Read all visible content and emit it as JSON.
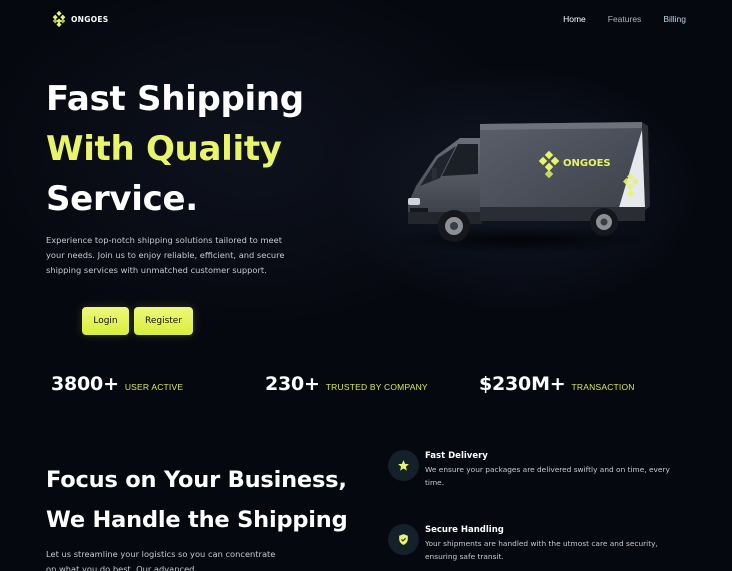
{
  "brand": {
    "name": "ONGOES",
    "accent": "#e8f46a"
  },
  "nav": {
    "items": [
      "Home",
      "Features",
      "Billing"
    ],
    "active": "Home"
  },
  "hero": {
    "title_line1": "Fast Shipping",
    "title_line2": "With Quality",
    "title_line3": "Service.",
    "description": "Experience top-notch shipping solutions tailored to meet your needs. Join us to enjoy reliable, efficient, and secure shipping services with unmatched customer support.",
    "login_label": "Login",
    "register_label": "Register",
    "truck_brand": "ONGOES"
  },
  "stats": [
    {
      "value": "3800+",
      "label": "USER ACTIVE"
    },
    {
      "value": "230+",
      "label": "TRUSTED BY COMPANY"
    },
    {
      "value": "$230M+",
      "label": "TRANSACTION"
    }
  ],
  "section2": {
    "title_line1": "Focus on Your Business,",
    "title_line2": "We Handle the Shipping",
    "description": "Let us streamline your logistics so you can concentrate on what you do best. Our advanced"
  },
  "features": [
    {
      "icon": "star-icon",
      "title": "Fast Delivery",
      "text": "We ensure your packages are delivered swiftly and on time, every time."
    },
    {
      "icon": "shield-check-icon",
      "title": "Secure Handling",
      "text": "Your shipments are handled with the utmost care and security, ensuring safe transit."
    }
  ]
}
